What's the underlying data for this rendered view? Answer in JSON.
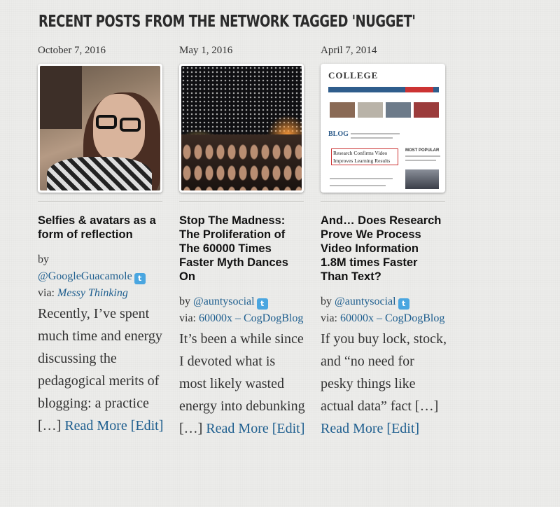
{
  "heading": "RECENT POSTS FROM THE NETWORK TAGGED 'NUGGET'",
  "posts": [
    {
      "date": "October 7, 2016",
      "title": "Selfies & avatars as a form of reflection",
      "by_label": "by",
      "author": "@GoogleGuacamole",
      "via_label": "via:",
      "source": "Messy Thinking",
      "excerpt": "Recently, I’ve spent much time and energy  discussing the pedagogical merits of blogging: a practice […]",
      "read_more": "Read More",
      "edit": "[Edit]",
      "thumbnail_icon": "selfie-photo"
    },
    {
      "date": "May 1, 2016",
      "title": "Stop The Madness: The Proliferation of The 60000 Times Faster Myth Dances On",
      "by_label": "by",
      "author": "@auntysocial",
      "via_label": "via:",
      "source": "60000x – CogDogBlog",
      "excerpt": "It’s been a while since I devoted what is most likely wasted energy into debunking […]",
      "read_more": "Read More",
      "edit": "[Edit]",
      "thumbnail_icon": "concert-photo"
    },
    {
      "date": "April 7, 2014",
      "title": "And… Does Research Prove We Process Video Information 1.8M times Faster Than Text?",
      "by_label": "by",
      "author": "@auntysocial",
      "via_label": "via:",
      "source": "60000x – CogDogBlog",
      "excerpt": "If you buy lock, stock, and “no need for pesky things like actual data” fact […]",
      "read_more": "Read More",
      "edit": "[Edit]",
      "thumbnail_icon": "website-screenshot",
      "thumb_text": {
        "site": "COLLEGE",
        "blog": "BLOG",
        "headline": "Research Confirms Video Improves Learning Results",
        "most_popular": "MOST POPULAR"
      }
    }
  ],
  "colors": {
    "link": "#1f5f8f",
    "twitter": "#4aa6e0",
    "background": "#ececea"
  }
}
